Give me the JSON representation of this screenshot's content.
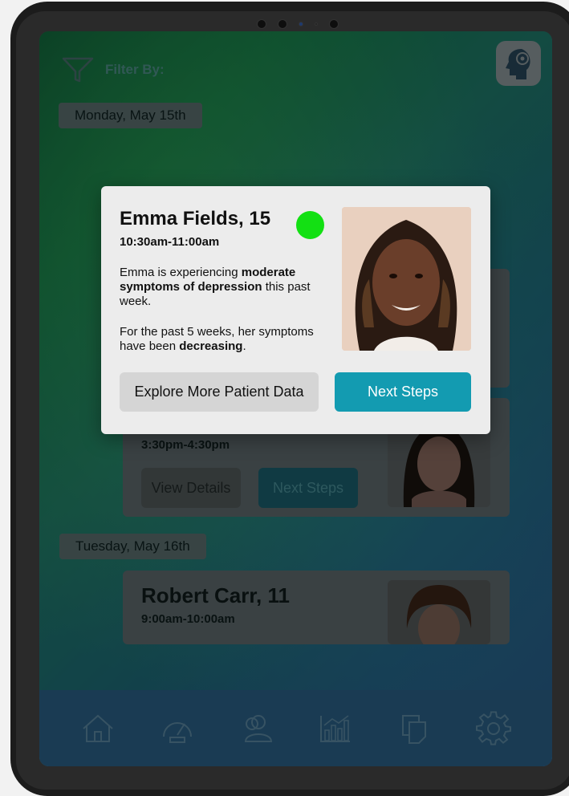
{
  "filter": {
    "label": "Filter By:"
  },
  "dates": [
    "Monday, May 15th",
    "Tuesday, May 16th"
  ],
  "cards": [
    {
      "time": "3:30pm-4:30pm",
      "view_label": "View Details",
      "next_label": "Next Steps"
    },
    {
      "name": "Robert Carr, 11",
      "time": "9:00am-10:00am"
    }
  ],
  "modal": {
    "name": "Emma Fields, 15",
    "time": "10:30am-11:00am",
    "status_color": "#13e013",
    "text1_pre": "Emma is experiencing ",
    "text1_bold": "moderate symptoms of depression",
    "text1_post": " this past week.",
    "text2_pre": "For the past 5 weeks, her symptoms have been ",
    "text2_bold": "decreasing",
    "text2_post": ".",
    "explore_label": "Explore More Patient Data",
    "next_label": "Next Steps"
  },
  "nav": [
    "home-icon",
    "dashboard-gauge-icon",
    "patients-icon",
    "analytics-chart-icon",
    "documents-icon",
    "settings-gear-icon"
  ],
  "colors": {
    "accent": "#139bb1",
    "status_green": "#13e013"
  }
}
